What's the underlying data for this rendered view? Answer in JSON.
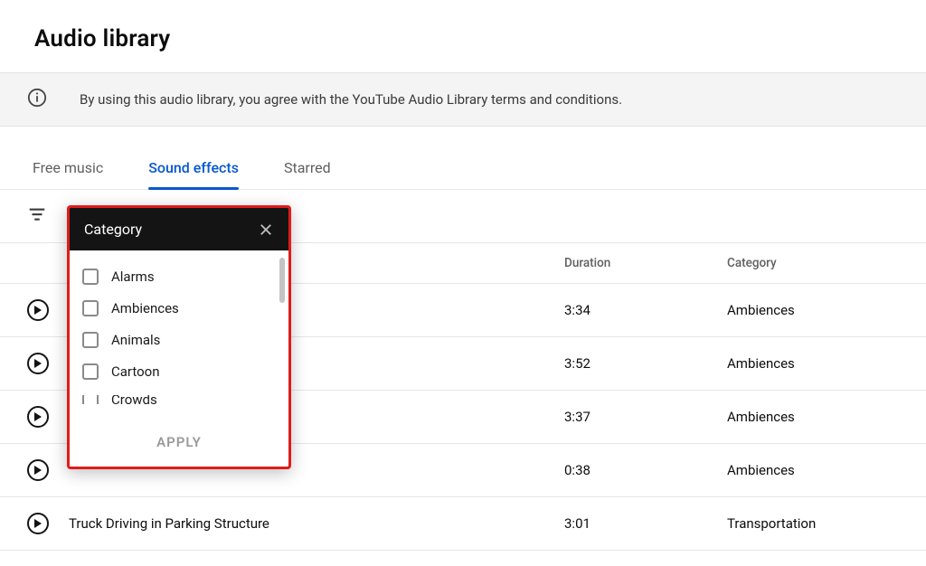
{
  "page": {
    "title": "Audio library"
  },
  "notice": {
    "text": "By using this audio library, you agree with the YouTube Audio Library terms and conditions."
  },
  "tabs": {
    "items": [
      {
        "label": "Free music",
        "active": false
      },
      {
        "label": "Sound effects",
        "active": true
      },
      {
        "label": "Starred",
        "active": false
      }
    ]
  },
  "columns": {
    "duration": "Duration",
    "category": "Category"
  },
  "tracks": [
    {
      "title": "",
      "duration": "3:34",
      "category": "Ambiences"
    },
    {
      "title": "",
      "duration": "3:52",
      "category": "Ambiences"
    },
    {
      "title": "",
      "duration": "3:37",
      "category": "Ambiences"
    },
    {
      "title": "",
      "duration": "0:38",
      "category": "Ambiences"
    },
    {
      "title": "Truck Driving in Parking Structure",
      "duration": "3:01",
      "category": "Transportation"
    }
  ],
  "filter_popup": {
    "title": "Category",
    "options": [
      {
        "label": "Alarms"
      },
      {
        "label": "Ambiences"
      },
      {
        "label": "Animals"
      },
      {
        "label": "Cartoon"
      },
      {
        "label": "Crowds"
      }
    ],
    "apply_label": "APPLY"
  }
}
